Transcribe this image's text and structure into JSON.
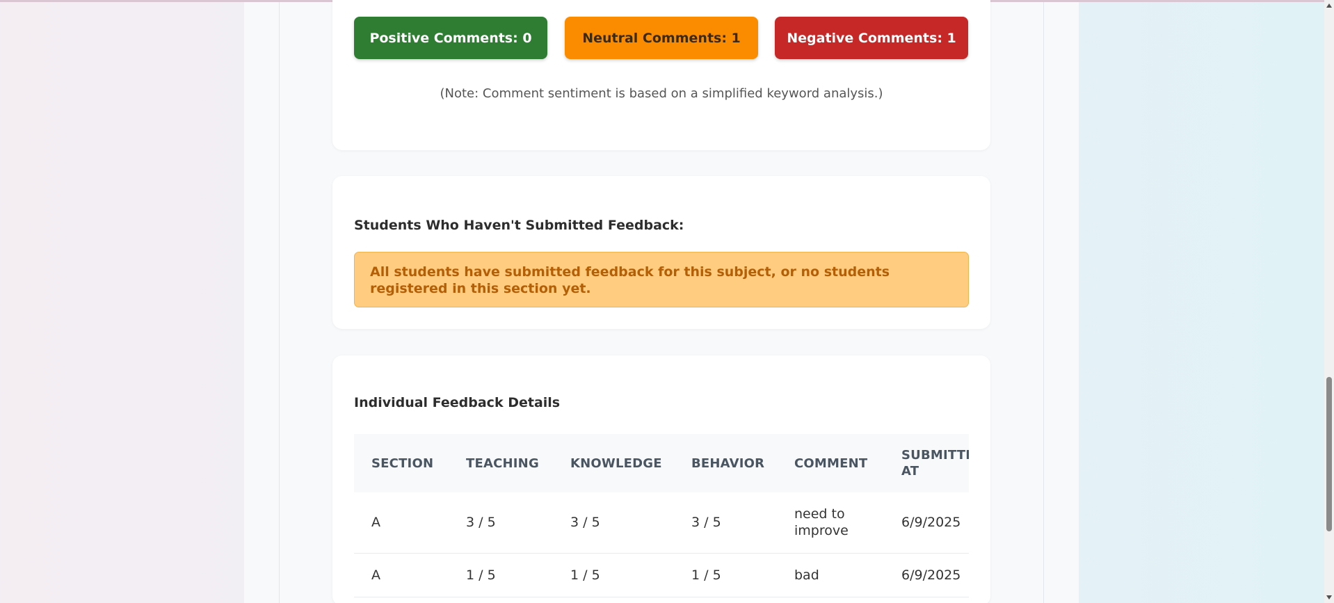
{
  "sentiment": {
    "positive_label": "Positive Comments: 0",
    "neutral_label": "Neutral Comments: 1",
    "negative_label": "Negative Comments: 1",
    "note": "(Note: Comment sentiment is based on a simplified keyword analysis.)",
    "colors": {
      "positive": "#2e7d32",
      "neutral": "#fb8c00",
      "negative": "#c62828"
    }
  },
  "missing": {
    "title": "Students Who Haven't Submitted Feedback:",
    "message": "All students have submitted feedback for this subject, or no students registered in this section yet."
  },
  "details": {
    "title": "Individual Feedback Details",
    "columns": [
      "SECTION",
      "TEACHING",
      "KNOWLEDGE",
      "BEHAVIOR",
      "COMMENT",
      "SUBMITTED AT"
    ],
    "rows": [
      [
        "A",
        "3 / 5",
        "3 / 5",
        "3 / 5",
        "need to improve",
        "6/9/2025"
      ],
      [
        "A",
        "1 / 5",
        "1 / 5",
        "1 / 5",
        "bad",
        "6/9/2025"
      ]
    ]
  }
}
